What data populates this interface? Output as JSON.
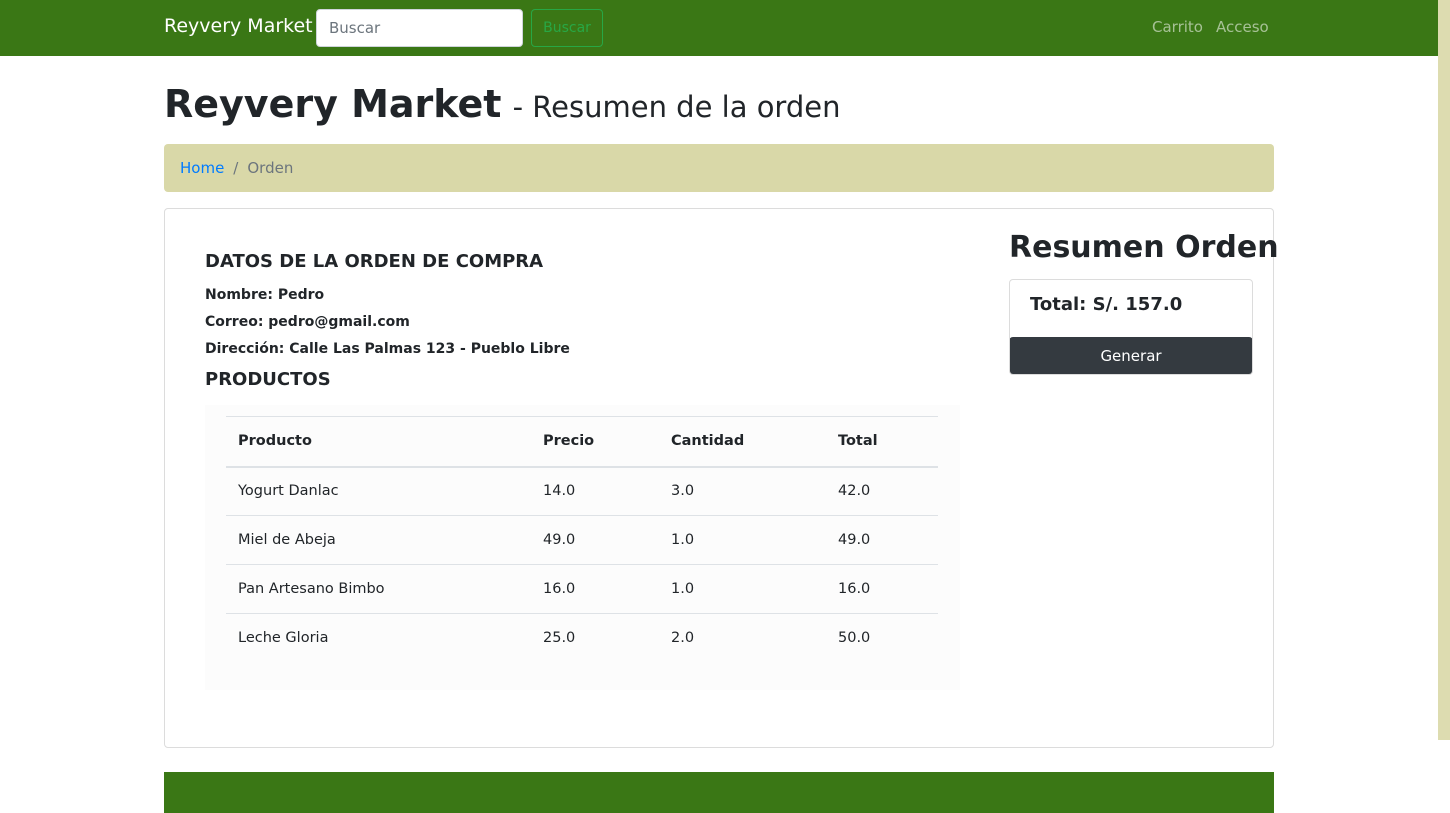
{
  "navbar": {
    "brand": "Reyvery Market",
    "search_placeholder": "Buscar",
    "search_value": "",
    "search_button": "Buscar",
    "links": {
      "cart": "Carrito",
      "access": "Acceso"
    }
  },
  "header": {
    "title": "Reyvery Market",
    "subtitle": "- Resumen de la orden"
  },
  "breadcrumb": {
    "home": "Home",
    "separator": "/",
    "current": "Orden"
  },
  "order": {
    "section_title": "DATOS DE LA ORDEN DE COMPRA",
    "name_line": "Nombre: Pedro",
    "email_line": "Correo: pedro@gmail.com",
    "address_line": "Dirección: Calle Las Palmas 123 - Pueblo Libre",
    "products_title": "PRODUCTOS",
    "table": {
      "headers": [
        "Producto",
        "Precio",
        "Cantidad",
        "Total"
      ],
      "rows": [
        [
          "Yogurt Danlac",
          "14.0",
          "3.0",
          "42.0"
        ],
        [
          "Miel de Abeja",
          "49.0",
          "1.0",
          "49.0"
        ],
        [
          "Pan Artesano Bimbo",
          "16.0",
          "1.0",
          "16.0"
        ],
        [
          "Leche Gloria",
          "25.0",
          "2.0",
          "50.0"
        ]
      ]
    }
  },
  "summary": {
    "title": "Resumen Orden",
    "total": "Total: S/. 157.0",
    "button": "Generar"
  },
  "colors": {
    "navbar": "#3a7715",
    "breadcrumb_bg": "#d9d8a8",
    "search_button": "#28a745",
    "generate_button": "#343a40"
  }
}
